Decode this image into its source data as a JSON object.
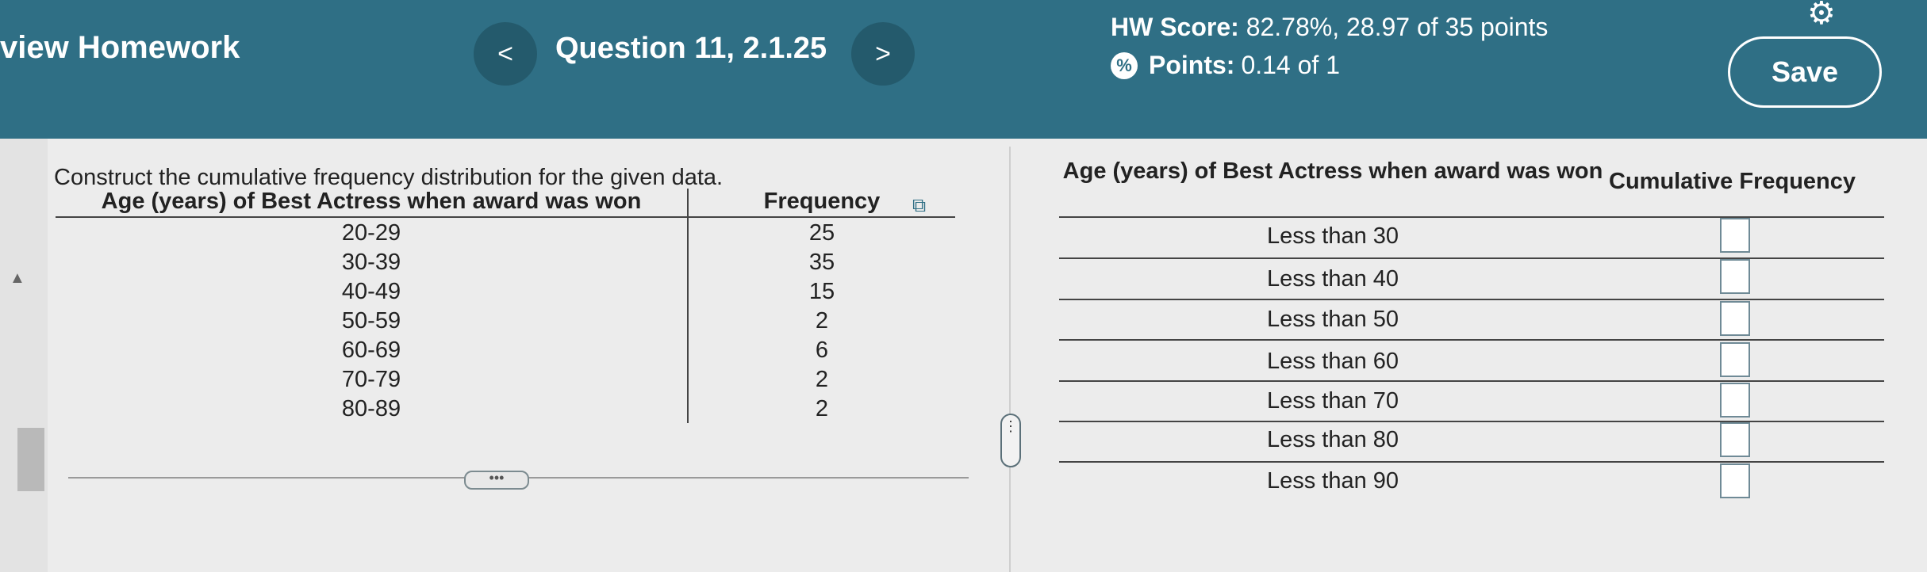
{
  "header": {
    "title": "view Homework",
    "prev_icon": "chevron-left-icon",
    "prev_label": "<",
    "question_label": "Question 11, 2.1.25",
    "next_icon": "chevron-right-icon",
    "next_label": ">",
    "hw_score_label": "HW Score:",
    "hw_score_value": "82.78%, 28.97 of 35 points",
    "points_icon": "partial-credit-icon",
    "points_label": "Points:",
    "points_value": "0.14 of 1",
    "settings_icon": "gear-icon",
    "save_label": "Save"
  },
  "colors": {
    "header_bg": "#2f6f85",
    "nav_button_bg": "#245a6c"
  },
  "question": {
    "instructions": "Construct the cumulative frequency distribution for the given data.",
    "table": {
      "headers": [
        "Age (years) of Best Actress when award was won",
        "Frequency"
      ],
      "rows": [
        [
          "20-29",
          "25"
        ],
        [
          "30-39",
          "35"
        ],
        [
          "40-49",
          "15"
        ],
        [
          "50-59",
          "2"
        ],
        [
          "60-69",
          "6"
        ],
        [
          "70-79",
          "2"
        ],
        [
          "80-89",
          "2"
        ]
      ]
    },
    "copy_icon": "copy-icon",
    "more_label": "•••"
  },
  "answer": {
    "header_age": "Age (years) of Best Actress when award was won",
    "header_cf": "Cumulative Frequency",
    "rows": [
      {
        "label": "Less than 30",
        "value": ""
      },
      {
        "label": "Less than 40",
        "value": ""
      },
      {
        "label": "Less than 50",
        "value": ""
      },
      {
        "label": "Less than 60",
        "value": ""
      },
      {
        "label": "Less than 70",
        "value": ""
      },
      {
        "label": "Less than 80",
        "value": ""
      },
      {
        "label": "Less than 90",
        "value": ""
      }
    ]
  },
  "divider_handle_label": "⋮"
}
